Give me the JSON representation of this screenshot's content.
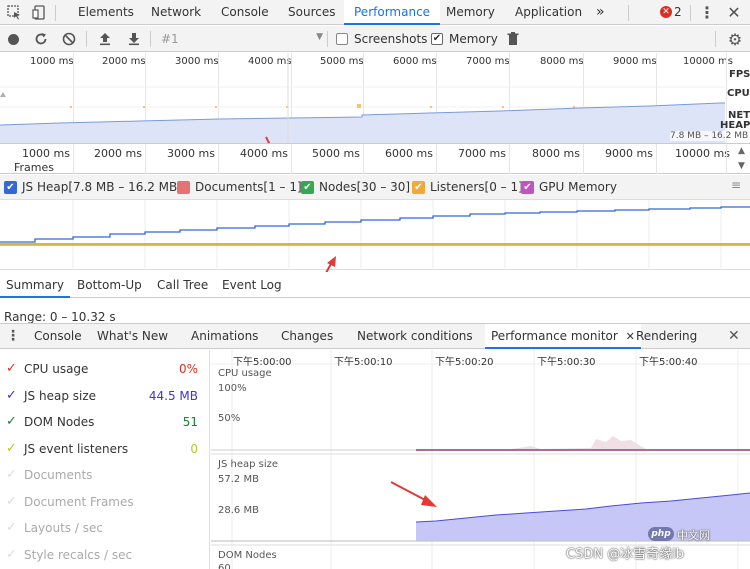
{
  "tabs": {
    "items": [
      "Elements",
      "Network",
      "Console",
      "Sources",
      "Performance",
      "Memory",
      "Application"
    ],
    "more": "»",
    "error_count": "2"
  },
  "toolbar": {
    "profile_select": "#1",
    "screenshots_label": "Screenshots",
    "memory_label": "Memory"
  },
  "overview": {
    "ticks": [
      "1000 ms",
      "2000 ms",
      "3000 ms",
      "4000 ms",
      "5000 ms",
      "6000 ms",
      "7000 ms",
      "8000 ms",
      "9000 ms",
      "10000 ms"
    ],
    "labels": {
      "fps": "FPS",
      "cpu": "CPU",
      "net": "NET",
      "heap": "HEAP"
    },
    "heap_range": "7.8 MB – 16.2 MB"
  },
  "ruler": {
    "ticks": [
      "1000 ms",
      "2000 ms",
      "3000 ms",
      "4000 ms",
      "5000 ms",
      "6000 ms",
      "7000 ms",
      "8000 ms",
      "9000 ms",
      "10000 ms"
    ],
    "frames_label": "Frames"
  },
  "legend": {
    "items": [
      {
        "label": "JS Heap[7.8 MB – 16.2 MB]",
        "color": "#3367d6",
        "checked": true
      },
      {
        "label": "Documents[1 – 1]",
        "color": "#e57373",
        "checked": false
      },
      {
        "label": "Nodes[30 – 30]",
        "color": "#34a853",
        "checked": true
      },
      {
        "label": "Listeners[0 – 1]",
        "color": "#f2a93b",
        "checked": true
      },
      {
        "label": "GPU Memory",
        "color": "#c353c3",
        "checked": true
      }
    ]
  },
  "subtabs": {
    "items": [
      "Summary",
      "Bottom-Up",
      "Call Tree",
      "Event Log"
    ]
  },
  "range": {
    "text": "Range: 0 – 10.32 s"
  },
  "drawer": {
    "items": [
      "Console",
      "What's New",
      "Animations",
      "Changes",
      "Network conditions",
      "Performance monitor",
      "Rendering"
    ]
  },
  "metrics": {
    "items": [
      {
        "name": "CPU usage",
        "value": "0%",
        "color": "#d93025",
        "active": true
      },
      {
        "name": "JS heap size",
        "value": "44.5 MB",
        "color": "#3f37c9",
        "active": true
      },
      {
        "name": "DOM Nodes",
        "value": "51",
        "color": "#188038",
        "active": true
      },
      {
        "name": "JS event listeners",
        "value": "0",
        "color": "#b5c827",
        "active": true
      },
      {
        "name": "Documents",
        "value": "",
        "color": "#ccc",
        "active": false
      },
      {
        "name": "Document Frames",
        "value": "",
        "color": "#ccc",
        "active": false
      },
      {
        "name": "Layouts / sec",
        "value": "",
        "color": "#ccc",
        "active": false
      },
      {
        "name": "Style recalcs / sec",
        "value": "",
        "color": "#ccc",
        "active": false
      }
    ]
  },
  "perf": {
    "timestamps": [
      "下午5:00:00",
      "下午5:00:10",
      "下午5:00:20",
      "下午5:00:30",
      "下午5:00:40"
    ],
    "cpu_label": "CPU usage",
    "cpu_100": "100%",
    "cpu_50": "50%",
    "heap_label": "JS heap size",
    "heap_max": "57.2 MB",
    "heap_mid": "28.6 MB",
    "dom_label": "DOM Nodes",
    "dom_tick": "60"
  },
  "watermark": {
    "text": "CSDN @冰雪奇缘lb",
    "logo": "php",
    "logo_sub": "中文网"
  },
  "colors": {
    "accent": "#1a73e8",
    "heap_fill": "#c7c7f7",
    "heap_line": "#4a4adb"
  }
}
